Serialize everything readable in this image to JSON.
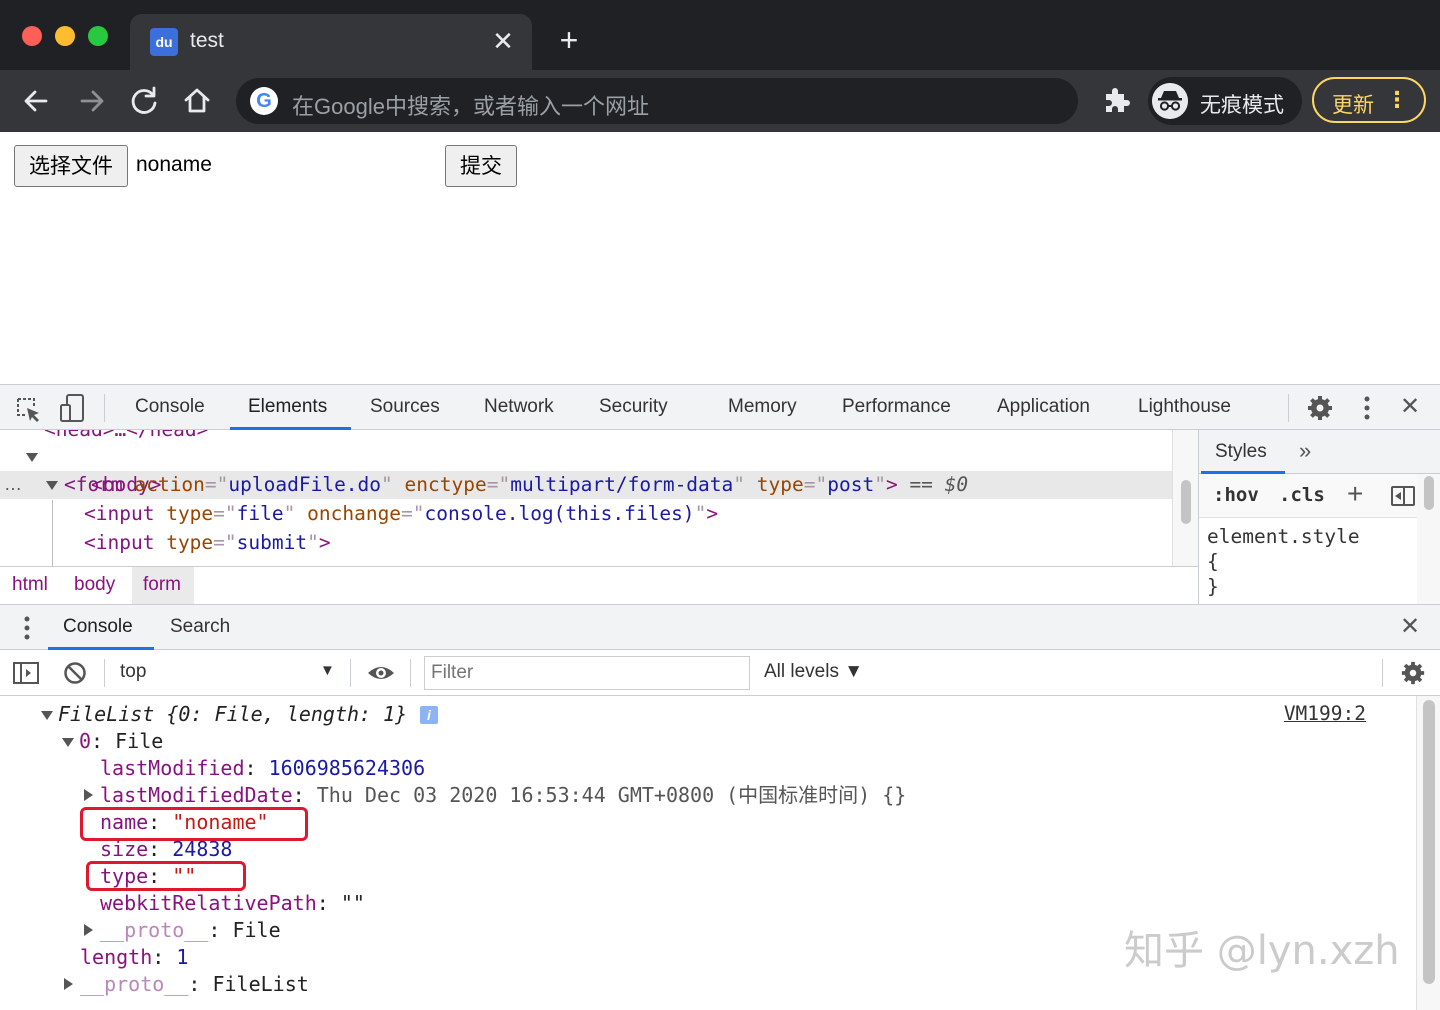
{
  "browser": {
    "tab": {
      "title": "test",
      "favicon_text": "du",
      "close_glyph": "✕"
    },
    "new_tab_glyph": "+",
    "omnibox": {
      "placeholder": "在Google中搜索，或者输入一个网址",
      "logo_text": "G"
    },
    "incognito_label": "无痕模式",
    "update_label": "更新",
    "update_menu_glyph": "⋮",
    "colors": {
      "tabstrip": "#202124",
      "toolbar": "#35363a",
      "update_accent": "#fdd663"
    }
  },
  "page": {
    "file_button_label": "选择文件",
    "file_name": "noname",
    "submit_label": "提交"
  },
  "devtools": {
    "tabs": [
      "Console",
      "Elements",
      "Sources",
      "Network",
      "Security",
      "Memory",
      "Performance",
      "Application",
      "Lighthouse"
    ],
    "active_tab": "Elements",
    "close_glyph": "✕",
    "elements": {
      "head_line": "<head>…</head>",
      "body_tag": "<body>",
      "form": {
        "tag": "form",
        "attrs": [
          {
            "name": "action",
            "value": "uploadFile.do"
          },
          {
            "name": "enctype",
            "value": "multipart/form-data"
          },
          {
            "name": "type",
            "value": "post"
          }
        ],
        "selection_marker": "== $0"
      },
      "input_file": {
        "tag": "input",
        "attrs": [
          {
            "name": "type",
            "value": "file"
          },
          {
            "name": "onchange",
            "value": "console.log(this.files)"
          }
        ]
      },
      "input_submit": {
        "tag": "input",
        "attrs": [
          {
            "name": "type",
            "value": "submit"
          }
        ]
      },
      "gutter_dots": "…"
    },
    "breadcrumbs": [
      "html",
      "body",
      "form"
    ],
    "styles": {
      "tab_label": "Styles",
      "more_glyph": "»",
      "hov_label": ":hov",
      "cls_label": ".cls",
      "plus_glyph": "+",
      "rule_selector": "element.style",
      "rule_open": "{",
      "rule_close": "}"
    },
    "drawer": {
      "tabs": [
        "Console",
        "Search"
      ],
      "active_tab": "Console",
      "close_glyph": "✕"
    },
    "console_toolbar": {
      "context": "top",
      "context_arrow": "▼",
      "filter_placeholder": "Filter",
      "levels": "All levels ▼"
    },
    "console_output": {
      "source_link": "VM199:2",
      "summary": "FileList {0: File, length: 1}",
      "info_badge": "i",
      "file_header": {
        "key": "0",
        "value": "File"
      },
      "properties": [
        {
          "key": "lastModified",
          "value": "1606985624306",
          "kind": "number"
        },
        {
          "key": "lastModifiedDate",
          "value": "Thu Dec 03 2020 16:53:44 GMT+0800 (中国标准时间) {}",
          "kind": "object"
        },
        {
          "key": "name",
          "value": "\"noname\"",
          "kind": "string"
        },
        {
          "key": "size",
          "value": "24838",
          "kind": "number"
        },
        {
          "key": "type",
          "value": "\"\"",
          "kind": "string"
        },
        {
          "key": "webkitRelativePath",
          "value": "\"\"",
          "kind": "string"
        },
        {
          "key": "__proto__",
          "value": "File",
          "kind": "proto"
        }
      ],
      "length": {
        "key": "length",
        "value": "1"
      },
      "proto": {
        "key": "__proto__",
        "value": "FileList"
      },
      "highlight_color": "#e0182f"
    }
  },
  "watermark": "知乎 @lyn.xzh"
}
